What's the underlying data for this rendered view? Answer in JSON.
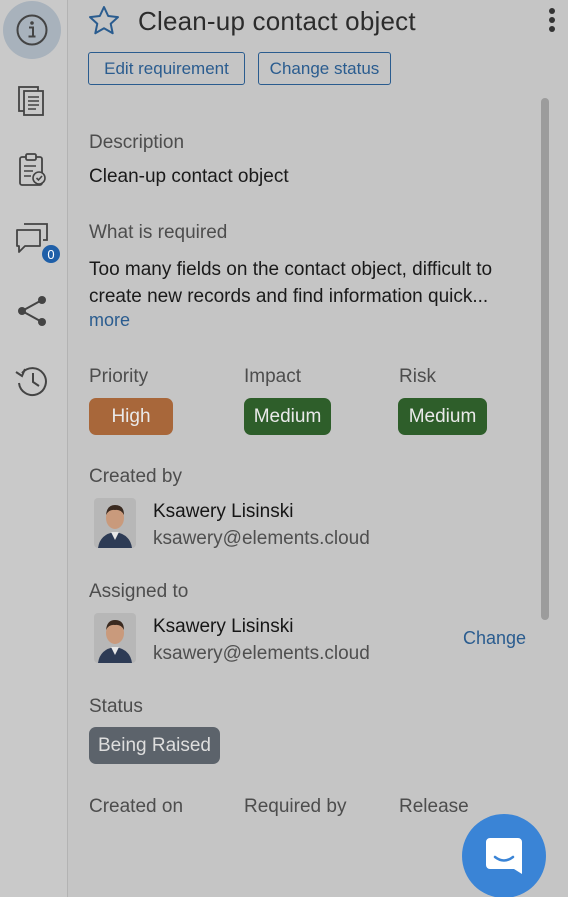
{
  "header": {
    "title": "Clean-up contact object",
    "edit_button": "Edit requirement",
    "status_button": "Change status"
  },
  "sidebar": {
    "items": [
      {
        "icon": "info-icon"
      },
      {
        "icon": "documents-icon"
      },
      {
        "icon": "clipboard-check-icon"
      },
      {
        "icon": "comments-icon",
        "badge": "0"
      },
      {
        "icon": "share-icon"
      },
      {
        "icon": "history-icon"
      }
    ]
  },
  "description": {
    "label": "Description",
    "value": "Clean-up contact object"
  },
  "required": {
    "label": "What is required",
    "text": "Too many fields on the contact object, difficult to create new records and find information quick...",
    "more": "more"
  },
  "ratings": {
    "priority": {
      "label": "Priority",
      "value": "High",
      "color": "#a8673a"
    },
    "impact": {
      "label": "Impact",
      "value": "Medium",
      "color": "#2e5e2a"
    },
    "risk": {
      "label": "Risk",
      "value": "Medium",
      "color": "#2e5e2a"
    }
  },
  "created_by": {
    "label": "Created by",
    "name": "Ksawery Lisinski",
    "email": "ksawery@elements.cloud"
  },
  "assigned_to": {
    "label": "Assigned to",
    "name": "Ksawery Lisinski",
    "email": "ksawery@elements.cloud",
    "change": "Change"
  },
  "status": {
    "label": "Status",
    "value": "Being Raised"
  },
  "dates": {
    "created_on": "Created on",
    "required_by": "Required by",
    "release": "Release"
  },
  "colors": {
    "accent": "#2a5c8f",
    "fab": "#3a84d6",
    "badge": "#1f5fa8"
  }
}
